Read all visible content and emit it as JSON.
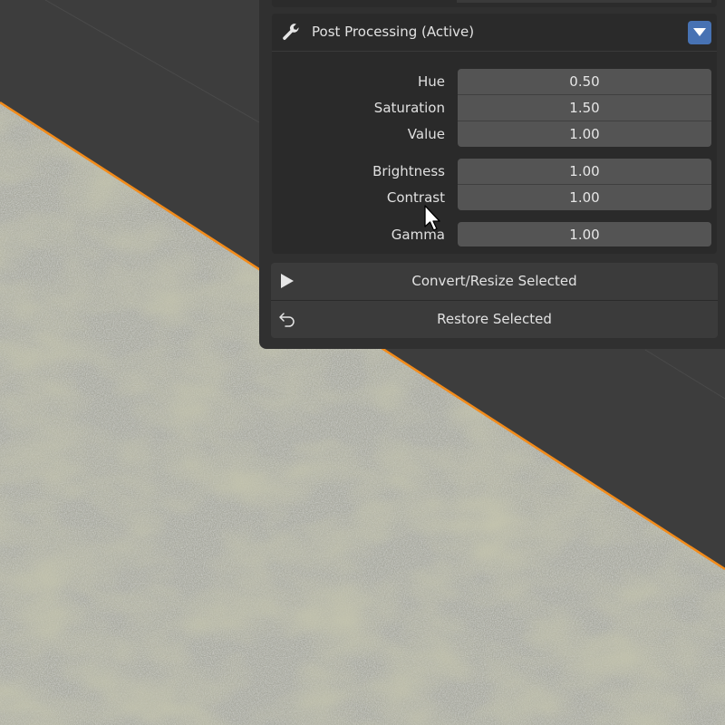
{
  "section": {
    "title": "Post Processing (Active)",
    "icon": "wrench-icon"
  },
  "properties": [
    {
      "label": "Hue",
      "value": "0.50"
    },
    {
      "label": "Saturation",
      "value": "1.50"
    },
    {
      "label": "Value",
      "value": "1.00"
    },
    {
      "label": "Brightness",
      "value": "1.00"
    },
    {
      "label": "Contrast",
      "value": "1.00"
    },
    {
      "label": "Gamma",
      "value": "1.00"
    }
  ],
  "actions": {
    "convert_label": "Convert/Resize Selected",
    "restore_label": "Restore Selected"
  },
  "colors": {
    "accent": "#4772b3",
    "selection_outline": "#f28b1a",
    "panel_bg": "#303030",
    "field_bg": "#545454",
    "viewport_bg": "#3d3d3d"
  }
}
